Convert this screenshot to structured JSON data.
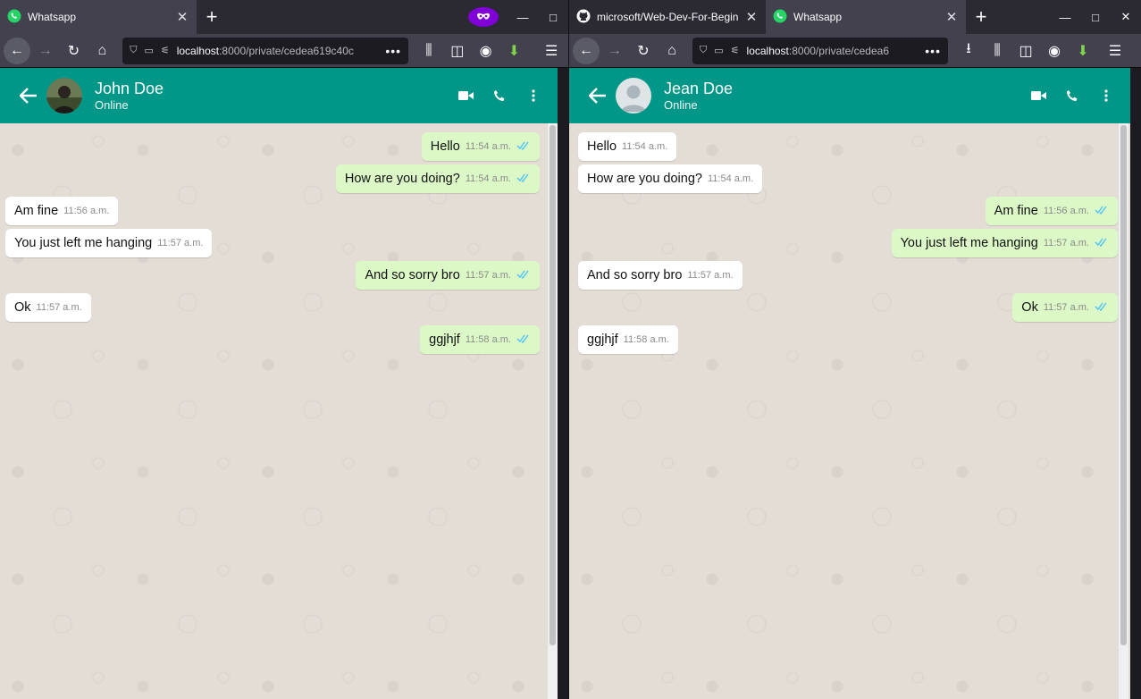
{
  "left": {
    "tabs": [
      {
        "title": "Whatsapp",
        "active": true
      }
    ],
    "url": {
      "host": "localhost",
      "rest": ":8000/private/cedea619c40c"
    },
    "contact": {
      "name": "John Doe",
      "status": "Online"
    },
    "messages": [
      {
        "dir": "out",
        "text": "Hello",
        "time": "11:54 a.m."
      },
      {
        "dir": "out",
        "text": "How are you doing?",
        "time": "11:54 a.m."
      },
      {
        "dir": "in",
        "text": "Am fine",
        "time": "11:56 a.m."
      },
      {
        "dir": "in",
        "text": "You just left me hanging",
        "time": "11:57 a.m."
      },
      {
        "dir": "out",
        "text": "And so sorry bro",
        "time": "11:57 a.m."
      },
      {
        "dir": "in",
        "text": "Ok",
        "time": "11:57 a.m."
      },
      {
        "dir": "out",
        "text": "ggjhjf",
        "time": "11:58 a.m."
      }
    ]
  },
  "right": {
    "tabs": [
      {
        "title": "microsoft/Web-Dev-For-Beginners",
        "active": false
      },
      {
        "title": "Whatsapp",
        "active": true
      }
    ],
    "url": {
      "host": "localhost",
      "rest": ":8000/private/cedea6"
    },
    "contact": {
      "name": "Jean Doe",
      "status": "Online"
    },
    "messages": [
      {
        "dir": "in",
        "text": "Hello",
        "time": "11:54 a.m."
      },
      {
        "dir": "in",
        "text": "How are you doing?",
        "time": "11:54 a.m."
      },
      {
        "dir": "out",
        "text": "Am fine",
        "time": "11:56 a.m."
      },
      {
        "dir": "out",
        "text": "You just left me hanging",
        "time": "11:57 a.m."
      },
      {
        "dir": "in",
        "text": "And so sorry bro",
        "time": "11:57 a.m."
      },
      {
        "dir": "out",
        "text": "Ok",
        "time": "11:57 a.m."
      },
      {
        "dir": "in",
        "text": "ggjhjf",
        "time": "11:58 a.m."
      }
    ]
  },
  "colors": {
    "header": "#009688",
    "outgoing": "#dcf8c6",
    "incoming": "#ffffff",
    "ticks": "#4fc3f7"
  },
  "icons": [
    "whatsapp-icon",
    "github-icon",
    "close-icon",
    "plus-icon",
    "private-mask-icon",
    "minimize-icon",
    "maximize-icon",
    "back-icon",
    "forward-icon",
    "reload-icon",
    "home-icon",
    "shield-icon",
    "page-icon",
    "permissions-icon",
    "more-icon",
    "library-icon",
    "sidebar-icon",
    "account-icon",
    "download-icon",
    "menu-icon",
    "arrow-back-icon",
    "video-icon",
    "phone-icon",
    "kebab-icon",
    "double-tick-icon"
  ]
}
